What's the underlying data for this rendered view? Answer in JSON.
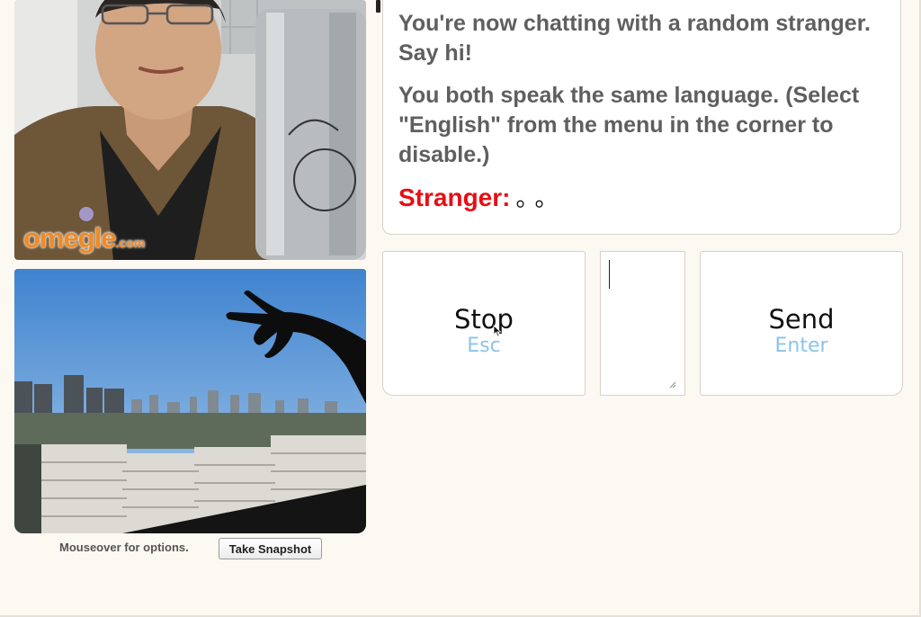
{
  "video": {
    "stranger": {
      "logo_main": "omegle",
      "logo_suffix": ".com"
    },
    "self": {}
  },
  "below_video": {
    "options_hint": "Mouseover for options.",
    "snapshot_label": "Take Snapshot"
  },
  "log": {
    "messages": [
      "You're now chatting with a random stranger. Say hi!",
      "You both speak the same language. (Select \"English\" from the menu in the corner to disable.)"
    ],
    "stranger_label": "Stranger:",
    "stranger_message": "。。"
  },
  "controls": {
    "stop": {
      "label": "Stop",
      "key": "Esc"
    },
    "send": {
      "label": "Send",
      "key": "Enter"
    },
    "input": {
      "value": ""
    }
  },
  "colors": {
    "page_background": "#fcf8f2",
    "stranger_label": "#e60f16",
    "key_hint": "#8cc3ea",
    "status_text": "#5f5f5f",
    "logo": "#f08a24"
  }
}
